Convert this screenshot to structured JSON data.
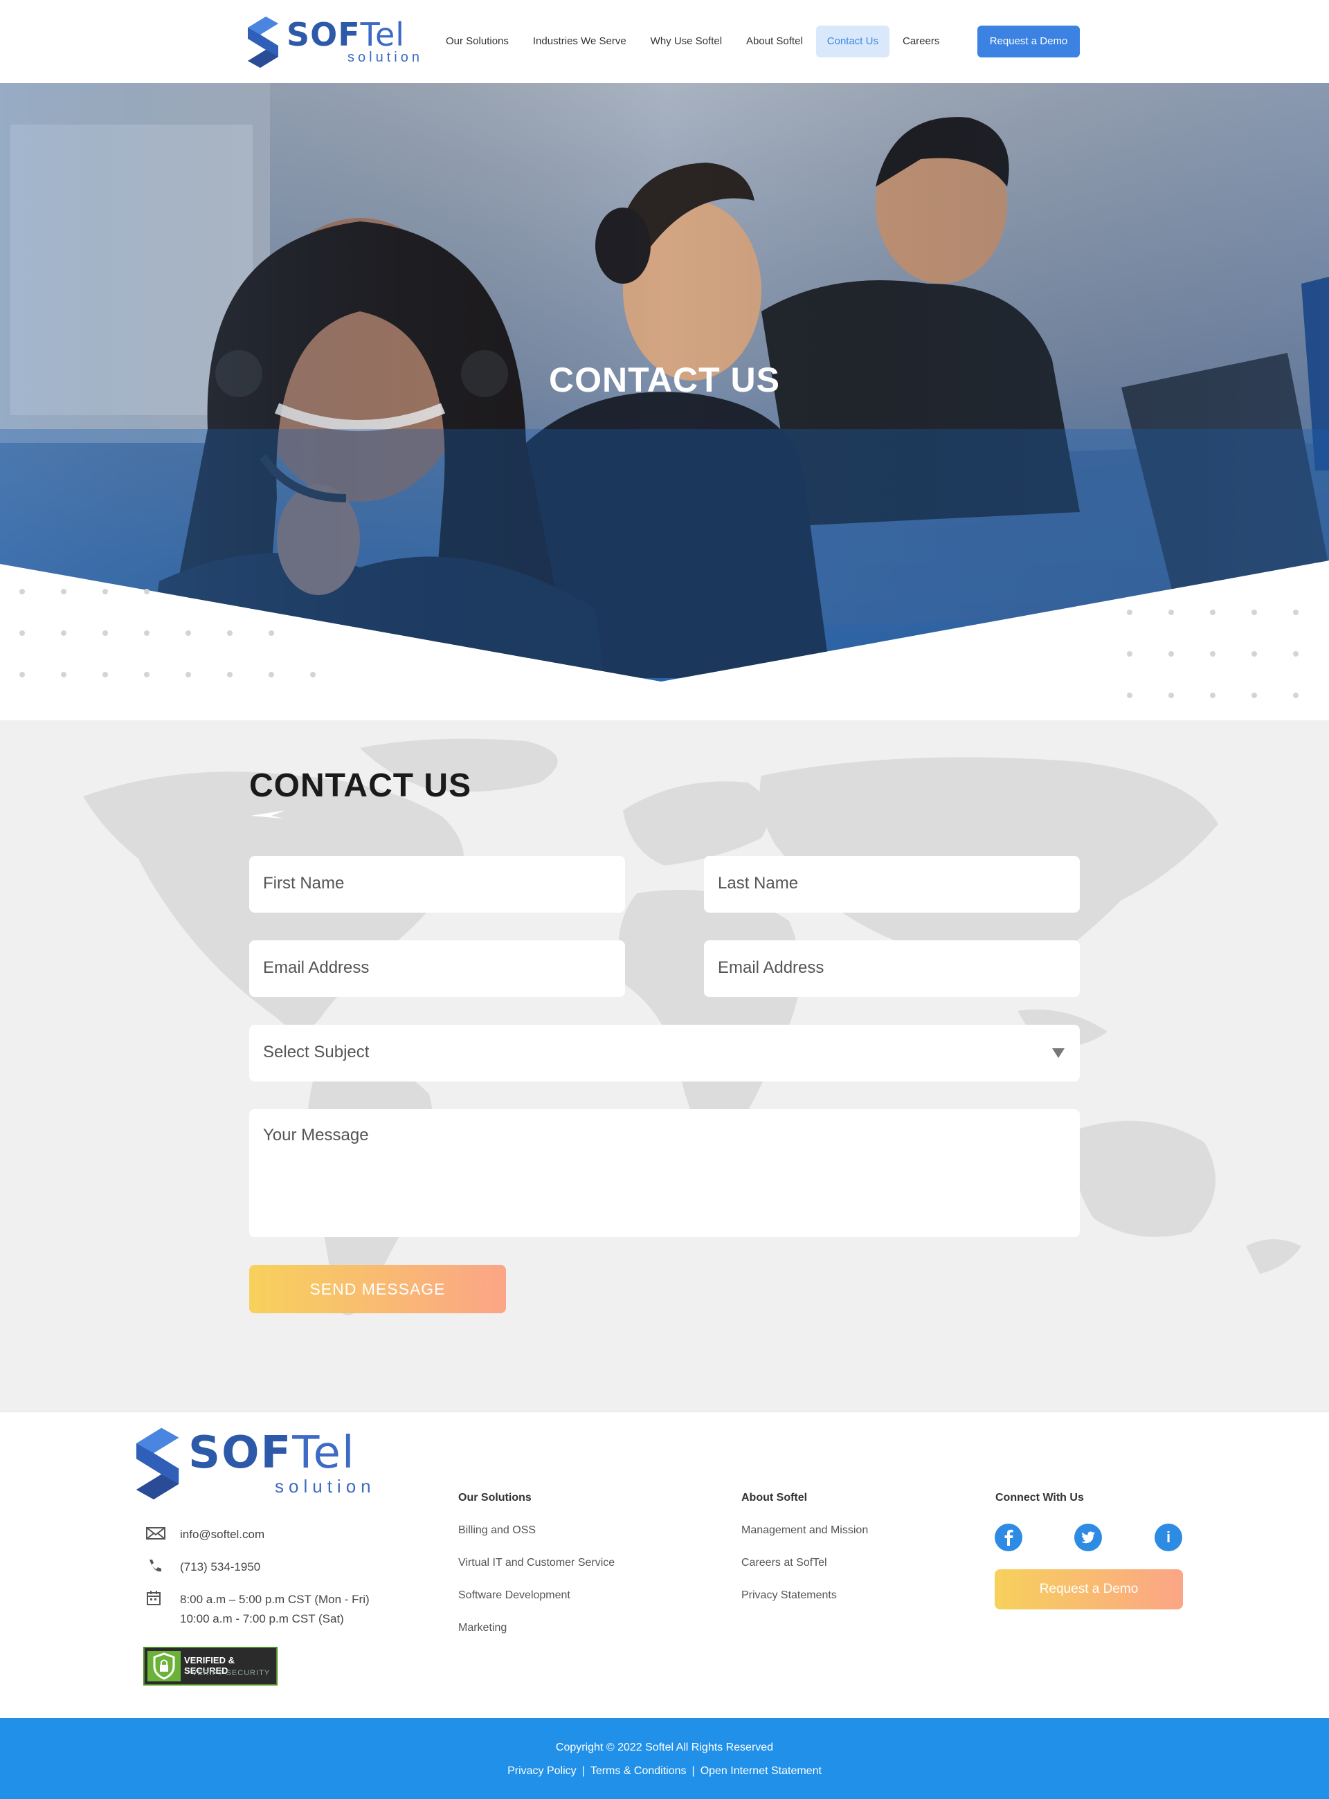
{
  "header": {
    "logo": {
      "brand_part1": "SOF",
      "brand_part2": "Tel",
      "tagline": "solution"
    },
    "nav": [
      {
        "label": "Our Solutions"
      },
      {
        "label": "Industries We Serve"
      },
      {
        "label": "Why Use Softel"
      },
      {
        "label": "About Softel"
      },
      {
        "label": "Contact Us",
        "active": true
      },
      {
        "label": "Careers"
      }
    ],
    "cta_label": "Request  a Demo"
  },
  "hero": {
    "title": "CONTACT US"
  },
  "contact_form": {
    "title": "CONTACT US",
    "first_name_placeholder": "First Name",
    "last_name_placeholder": "Last Name",
    "email_placeholder": "Email Address",
    "email2_placeholder": "Email Address",
    "subject_placeholder": "Select Subject",
    "message_placeholder": "Your Message",
    "submit_label": "SEND MESSAGE"
  },
  "footer": {
    "logo": {
      "brand_part1": "SOF",
      "brand_part2": "Tel",
      "tagline": "solution"
    },
    "contact": {
      "email": "info@softel.com",
      "phone": "(713) 534-1950",
      "hours_weekday": "8:00 a.m – 5:00 p.m CST (Mon - Fri)",
      "hours_saturday": "10:00 a.m - 7:00 p.m CST (Sat)"
    },
    "badge": {
      "line1": "VERIFIED & SECURED",
      "line2": "VERIFY SECURITY"
    },
    "solutions": {
      "title": "Our Solutions",
      "links": [
        "Billing and OSS",
        "Virtual IT and Customer Service",
        "Software Development",
        "Marketing"
      ]
    },
    "about": {
      "title": "About Softel",
      "links": [
        "Management and Mission",
        "Careers at SofTel",
        "Privacy Statements"
      ]
    },
    "connect": {
      "title": "Connect With Us",
      "social": [
        {
          "icon": "facebook-icon",
          "glyph": "f"
        },
        {
          "icon": "twitter-icon",
          "glyph": "t"
        },
        {
          "icon": "info-icon",
          "glyph": "i"
        }
      ],
      "cta_label": "Request  a Demo"
    }
  },
  "bottom_bar": {
    "copyright": "Copyright © 2022 Softel All Rights Reserved",
    "links": [
      "Privacy Policy",
      "Terms & Conditions",
      "Open Internet Statement"
    ]
  },
  "colors": {
    "brand_blue": "#2d59a9",
    "nav_cta": "#3b82e3",
    "active_nav_bg": "#d9e9fb",
    "footer_bar": "#2190e8",
    "cta_gradient_start": "#f7d15c",
    "cta_gradient_end": "#fba586"
  }
}
